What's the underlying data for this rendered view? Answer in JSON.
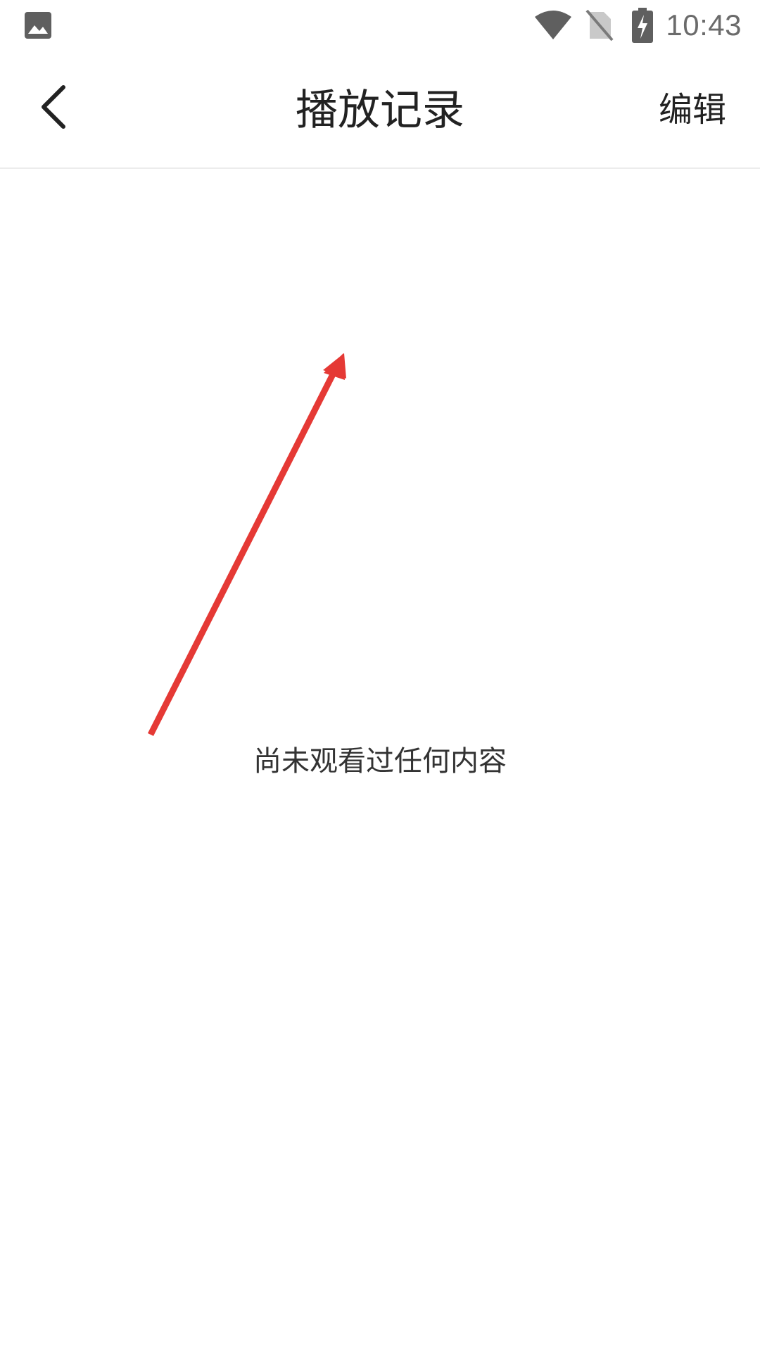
{
  "status_bar": {
    "time": "10:43",
    "icons": [
      "gallery-icon",
      "wifi-icon",
      "no-sim-icon",
      "battery-charging-icon"
    ]
  },
  "header": {
    "title": "播放记录",
    "back_icon": "chevron-left-icon",
    "edit_label": "编辑"
  },
  "content": {
    "empty_message": "尚未观看过任何内容"
  },
  "annotation": {
    "type": "arrow",
    "color": "#e53935"
  }
}
